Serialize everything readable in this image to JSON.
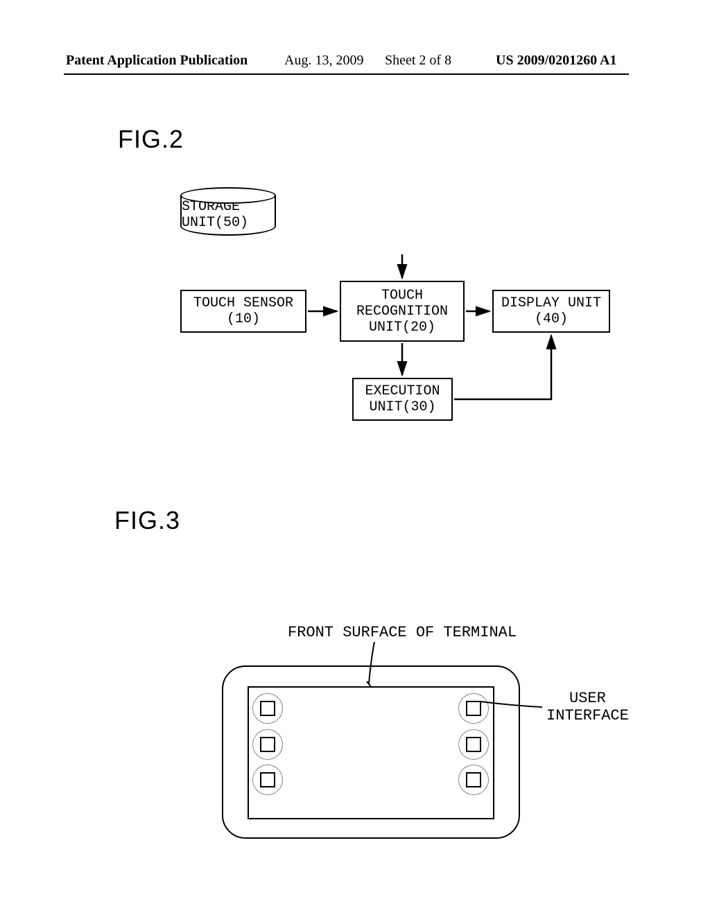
{
  "header": {
    "pubtype": "Patent Application Publication",
    "date": "Aug. 13, 2009",
    "sheet": "Sheet 2 of 8",
    "pubnum": "US 2009/0201260 A1"
  },
  "fig2": {
    "label": "FIG.2",
    "storage": {
      "line1": "STORAGE",
      "line2": "UNIT(50)"
    },
    "sensor": {
      "line1": "TOUCH SENSOR",
      "line2": "(10)"
    },
    "recog": {
      "line1": "TOUCH",
      "line2": "RECOGNITION",
      "line3": "UNIT(20)"
    },
    "display": {
      "line1": "DISPLAY UNIT",
      "line2": "(40)"
    },
    "exec": {
      "line1": "EXECUTION",
      "line2": "UNIT(30)"
    }
  },
  "fig3": {
    "label": "FIG.3",
    "label_front": "FRONT SURFACE OF TERMINAL",
    "label_ui_1": "USER",
    "label_ui_2": "INTERFACE"
  }
}
